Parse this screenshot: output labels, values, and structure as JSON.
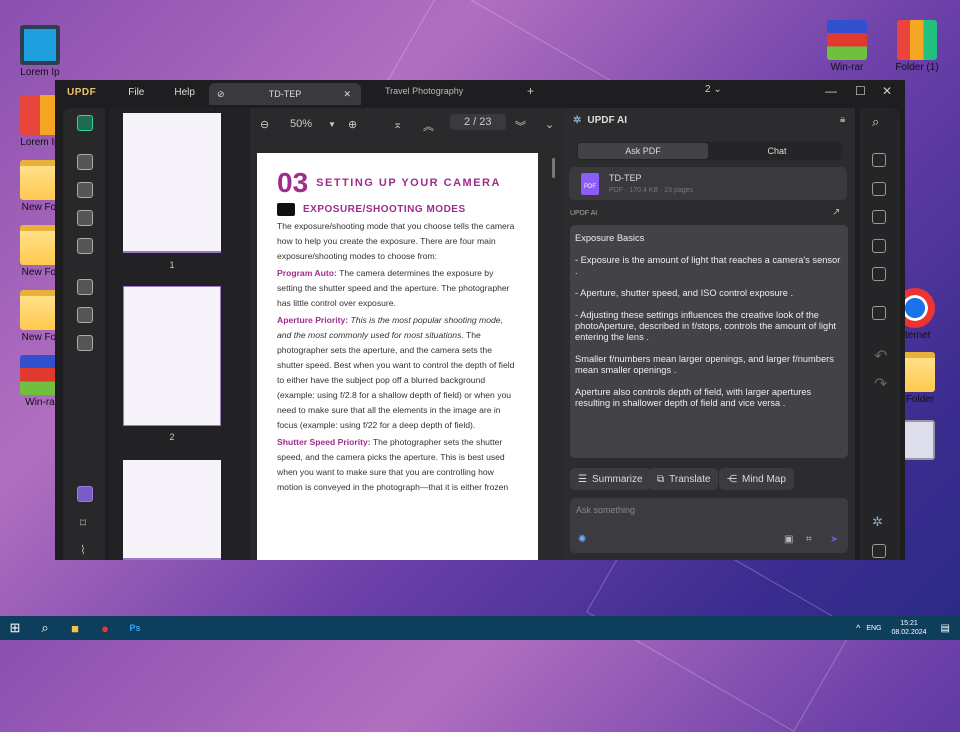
{
  "desktop": {
    "left_icons": [
      "Lorem Ip",
      "Lorem Ip",
      "New Fol",
      "New Fol",
      "New Fol",
      "Win-ra"
    ],
    "right_icons": [
      "Win-rar",
      "Folder (1)",
      "nternet",
      "w Folder"
    ]
  },
  "app": {
    "logo": "UPDF",
    "menu": [
      "File",
      "Help"
    ],
    "tabs": [
      {
        "label": "TD-TEP",
        "active": true
      },
      {
        "label": "Travel Photography"
      }
    ],
    "tab_count": "2"
  },
  "toolbar": {
    "zoom": "50%",
    "page_current": "2",
    "page_total": "23",
    "page_display": "2 / 23"
  },
  "thumbnails": {
    "pages": [
      "1",
      "2"
    ]
  },
  "document": {
    "chapter_number": "03",
    "chapter_title": "SETTING UP YOUR CAMERA",
    "section_title": "EXPOSURE/SHOOTING MODES",
    "intro": "The exposure/shooting mode that you choose tells the camera how to help you create the exposure. There are four main exposure/shooting modes to choose from:",
    "items": [
      {
        "term": "Program Auto:",
        "italic": "",
        "text": " The camera determines the exposure by setting the shutter speed and the aperture. The photographer has little control over exposure."
      },
      {
        "term": "Aperture Priority:",
        "italic": " This is the most popular shooting mode, and the most commonly used for most situations.",
        "text": " The photographer sets the aperture, and the camera sets the shutter speed. Best when you want to control the depth of field to either have the subject pop off a blurred background (example: using f/2.8 for a shallow depth of field) or when you need to make sure that all the elements in the image are in focus (example: using f/22 for a deep depth of field)."
      },
      {
        "term": "Shutter Speed Priority:",
        "italic": "",
        "text": " The photographer sets the shutter speed, and the camera picks the aperture. This is best used when you want to make sure that you are controlling how motion is conveyed in the photograph—that it is either frozen"
      }
    ]
  },
  "ai": {
    "title": "UPDF AI",
    "tabs": [
      "Ask PDF",
      "Chat"
    ],
    "file": {
      "name": "TD-TEP",
      "meta": "PDF · 170.4 KB · 23 pages",
      "badge": "PDF"
    },
    "section_label": "UPDF AI",
    "response": [
      "Exposure Basics",
      "- Exposure is the amount of light that reaches a camera's sensor .",
      "- Aperture, shutter speed, and ISO control exposure .",
      "- Adjusting these settings influences the creative look of the photoAperture, described in f/stops, controls the amount of light entering the lens .",
      "Smaller f/numbers mean larger openings, and larger f/numbers mean smaller openings .",
      "Aperture also controls depth of field, with larger apertures resulting in shallower depth of field and vice versa ."
    ],
    "actions": [
      "Summarize",
      "Translate",
      "Mind Map"
    ],
    "input_placeholder": "Ask something"
  },
  "taskbar": {
    "lang": "ENG",
    "time": "15:21",
    "date": "08.02.2024"
  }
}
